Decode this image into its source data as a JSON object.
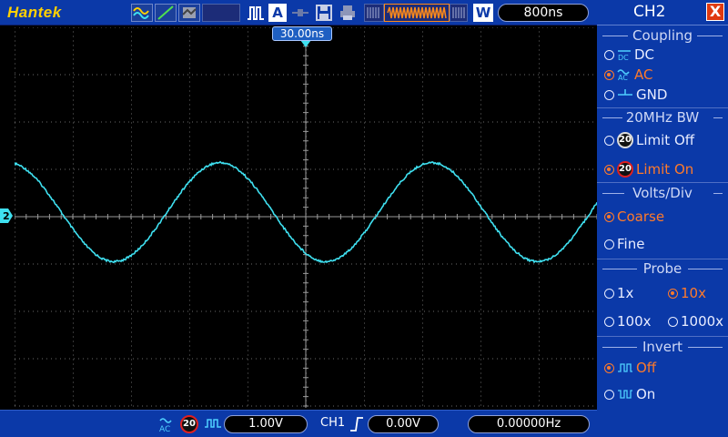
{
  "toolbar": {
    "brand": "Hantek",
    "timebase": "800ns",
    "acq_mode_label": "A",
    "wide_label": "W"
  },
  "screen": {
    "trigger_position": "30.00ns",
    "channel_marker": "2"
  },
  "bottom": {
    "ch2_volts": "1.00V",
    "trigger_source": "CH1",
    "trigger_level": "0.00V",
    "frequency": "0.00000Hz"
  },
  "menu": {
    "title": "CH2",
    "close_label": "X",
    "coupling": {
      "heading": "Coupling",
      "options": [
        "DC",
        "AC",
        "GND"
      ],
      "selected": "AC"
    },
    "bw_limit": {
      "heading": "20MHz BW",
      "options": [
        "Limit Off",
        "Limit On"
      ],
      "badge": "20",
      "selected": "Limit On"
    },
    "volts_div": {
      "heading": "Volts/Div",
      "options": [
        "Coarse",
        "Fine"
      ],
      "selected": "Coarse"
    },
    "probe": {
      "heading": "Probe",
      "options": [
        "1x",
        "10x",
        "100x",
        "1000x"
      ],
      "selected": "10x"
    },
    "invert": {
      "heading": "Invert",
      "options": [
        "Off",
        "On"
      ],
      "selected": "Off"
    }
  },
  "colors": {
    "panel_blue": "#0b39a8",
    "trace_cyan": "#3fe0f0",
    "selected_orange": "#ff7a2a",
    "brand_yellow": "#ffd000"
  },
  "waveform": {
    "channel": "CH2",
    "cycles_visible": 2.75,
    "amplitude_divs": 1.1,
    "phase_cycles": 0.28
  }
}
